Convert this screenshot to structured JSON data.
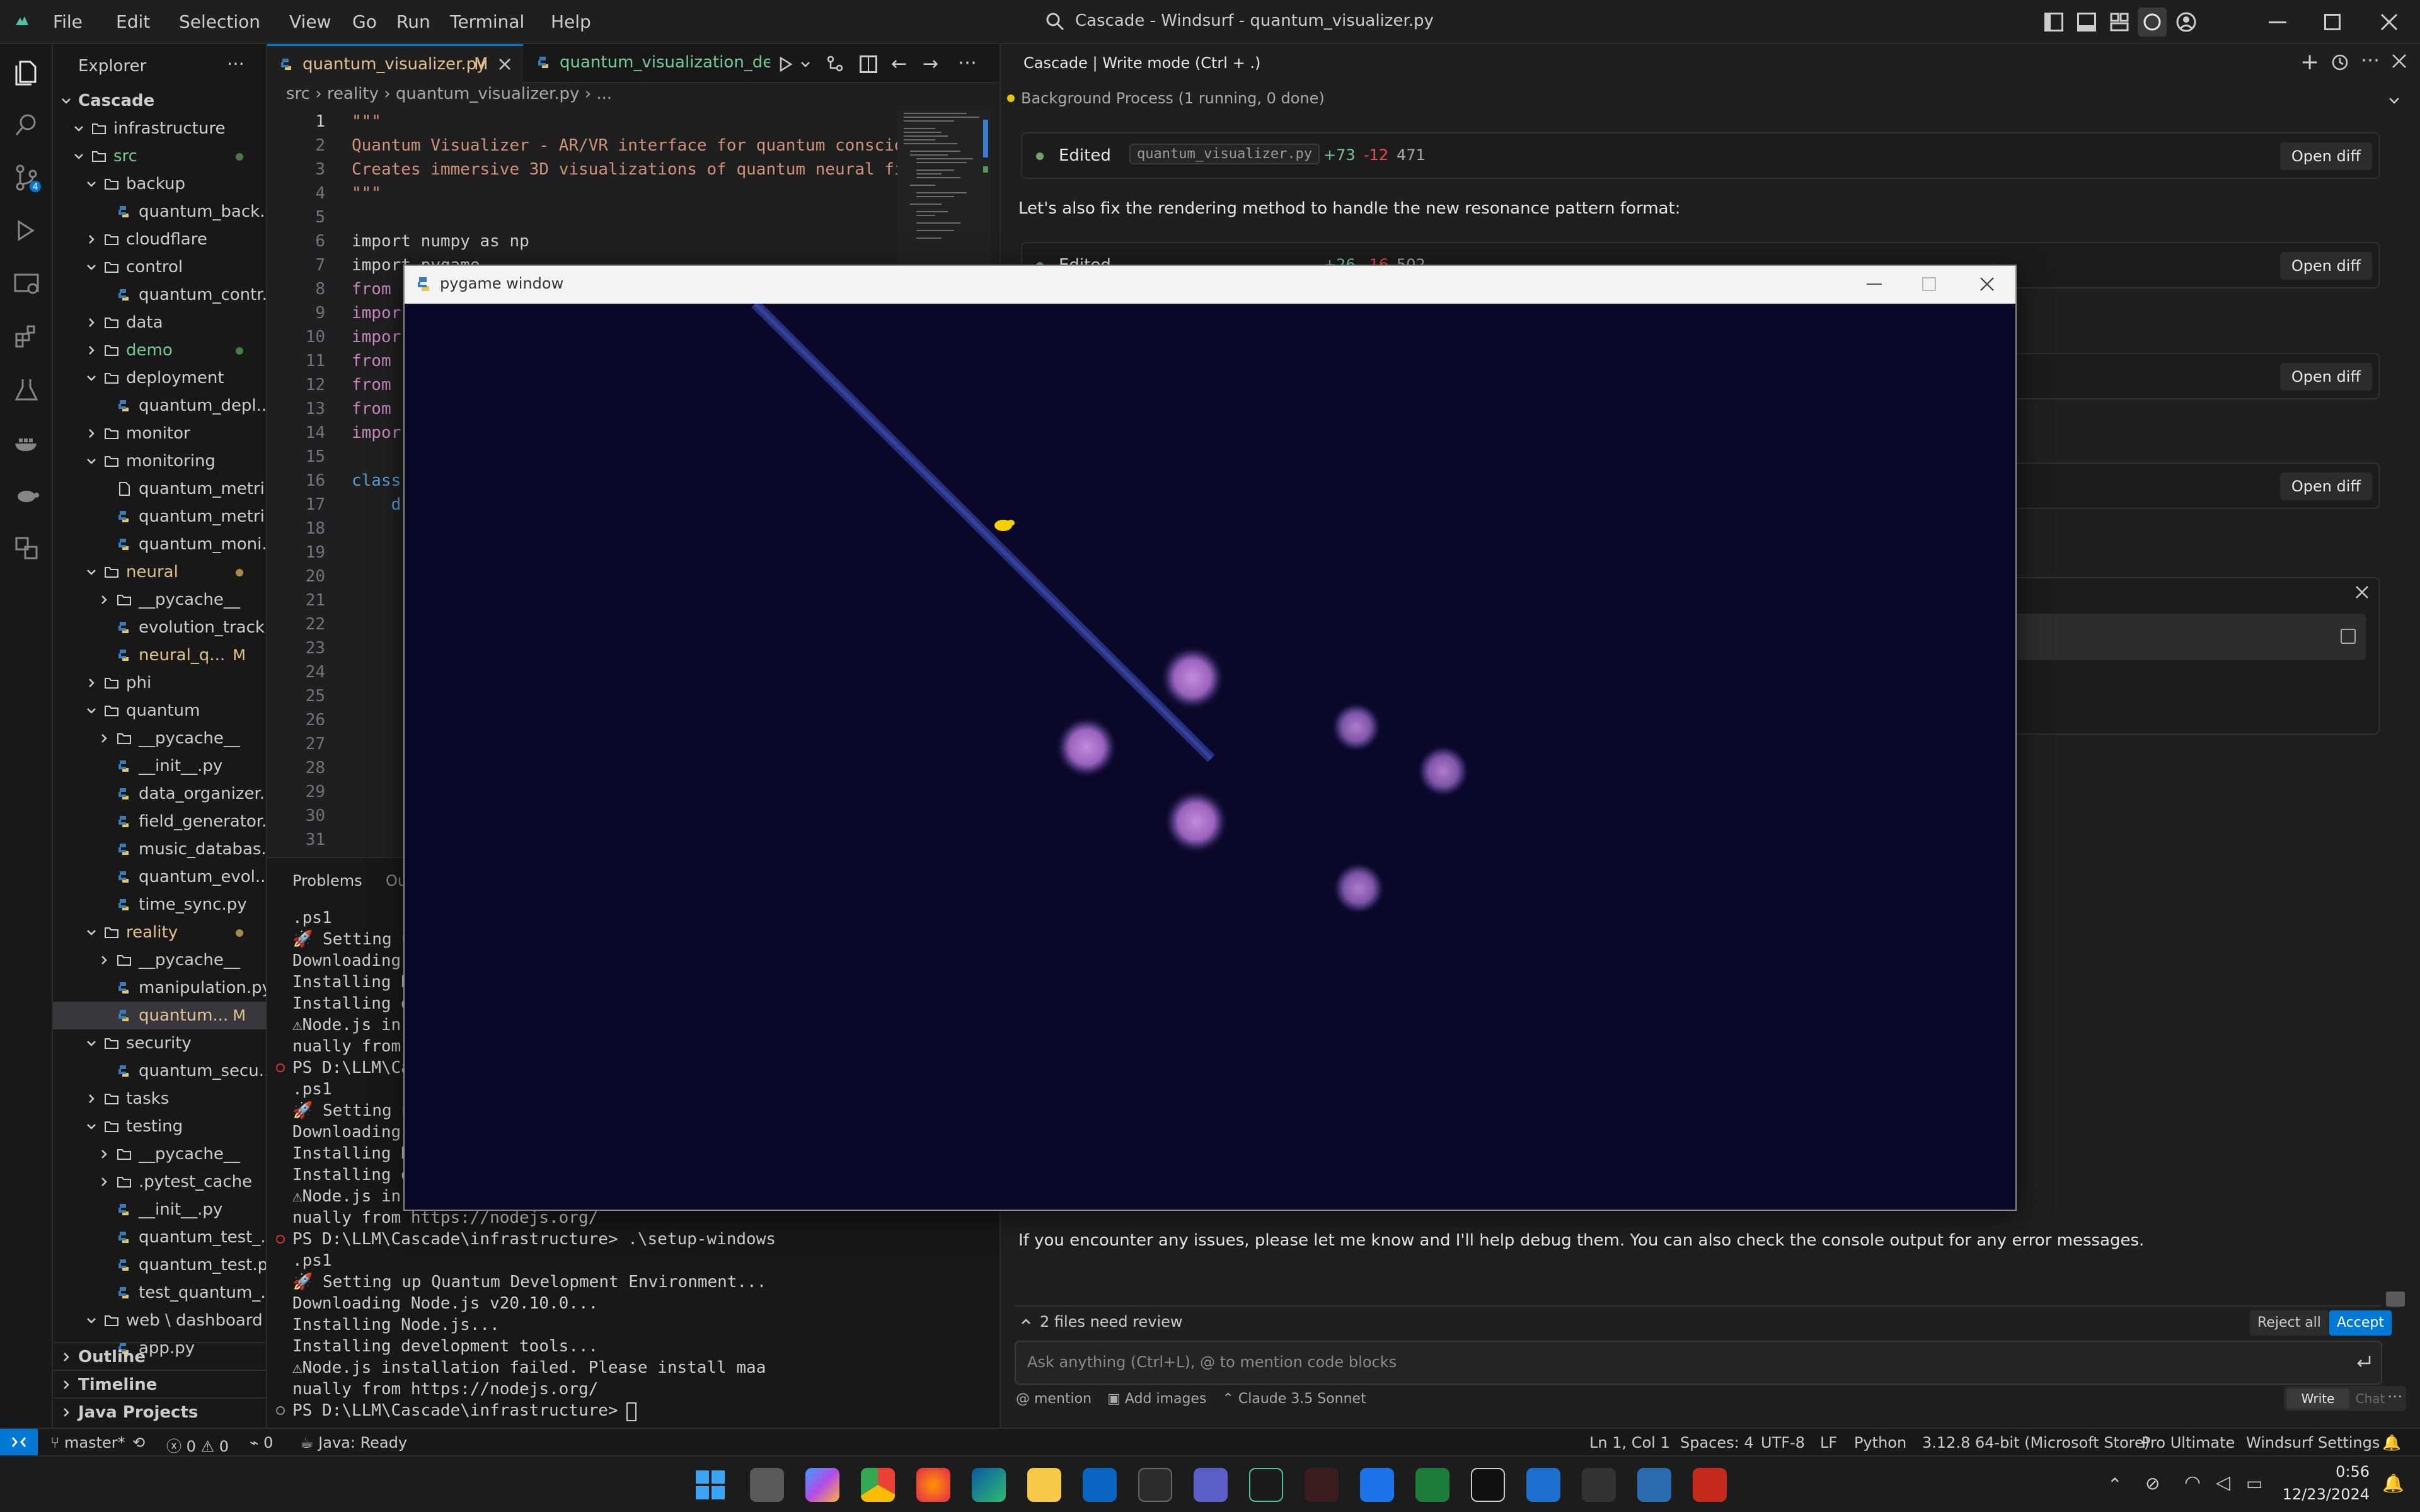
{
  "menu": [
    "File",
    "Edit",
    "Selection",
    "View",
    "Go",
    "Run",
    "Terminal",
    "Help"
  ],
  "window_title": "Cascade - Windsurf - quantum_visualizer.py",
  "explorer": {
    "title": "Explorer",
    "root": "Cascade",
    "items": [
      {
        "label": "infrastructure",
        "depth": 1,
        "type": "folder",
        "open": true
      },
      {
        "label": "src",
        "depth": 1,
        "type": "folder",
        "open": true,
        "color": "green",
        "dot": true
      },
      {
        "label": "backup",
        "depth": 2,
        "type": "folder",
        "open": true
      },
      {
        "label": "quantum_back...",
        "depth": 3,
        "type": "py"
      },
      {
        "label": "cloudflare",
        "depth": 2,
        "type": "folder",
        "open": false
      },
      {
        "label": "control",
        "depth": 2,
        "type": "folder",
        "open": true
      },
      {
        "label": "quantum_contr...",
        "depth": 3,
        "type": "py"
      },
      {
        "label": "data",
        "depth": 2,
        "type": "folder",
        "open": false
      },
      {
        "label": "demo",
        "depth": 2,
        "type": "folder",
        "open": false,
        "color": "green",
        "dot": true
      },
      {
        "label": "deployment",
        "depth": 2,
        "type": "folder",
        "open": true
      },
      {
        "label": "quantum_depl...",
        "depth": 3,
        "type": "py"
      },
      {
        "label": "monitor",
        "depth": 2,
        "type": "folder",
        "open": false
      },
      {
        "label": "monitoring",
        "depth": 2,
        "type": "folder",
        "open": true
      },
      {
        "label": "quantum_metri...",
        "depth": 3,
        "type": "file"
      },
      {
        "label": "quantum_metri...",
        "depth": 3,
        "type": "py"
      },
      {
        "label": "quantum_moni...",
        "depth": 3,
        "type": "py"
      },
      {
        "label": "neural",
        "depth": 2,
        "type": "folder",
        "open": true,
        "color": "yellow",
        "dot": true
      },
      {
        "label": "__pycache__",
        "depth": 3,
        "type": "folder",
        "open": false
      },
      {
        "label": "evolution_track...",
        "depth": 3,
        "type": "py"
      },
      {
        "label": "neural_q...",
        "depth": 3,
        "type": "py",
        "color": "yellow",
        "badge": "M"
      },
      {
        "label": "phi",
        "depth": 2,
        "type": "folder",
        "open": false
      },
      {
        "label": "quantum",
        "depth": 2,
        "type": "folder",
        "open": true
      },
      {
        "label": "__pycache__",
        "depth": 3,
        "type": "folder",
        "open": false
      },
      {
        "label": "__init__.py",
        "depth": 3,
        "type": "py"
      },
      {
        "label": "data_organizer...",
        "depth": 3,
        "type": "py"
      },
      {
        "label": "field_generator...",
        "depth": 3,
        "type": "py"
      },
      {
        "label": "music_databas...",
        "depth": 3,
        "type": "py"
      },
      {
        "label": "quantum_evol...",
        "depth": 3,
        "type": "py"
      },
      {
        "label": "time_sync.py",
        "depth": 3,
        "type": "py"
      },
      {
        "label": "reality",
        "depth": 2,
        "type": "folder",
        "open": true,
        "color": "yellow",
        "dot": true
      },
      {
        "label": "__pycache__",
        "depth": 3,
        "type": "folder",
        "open": false
      },
      {
        "label": "manipulation.py",
        "depth": 3,
        "type": "py"
      },
      {
        "label": "quantum...",
        "depth": 3,
        "type": "py",
        "color": "yellow",
        "badge": "M",
        "selected": true
      },
      {
        "label": "security",
        "depth": 2,
        "type": "folder",
        "open": true
      },
      {
        "label": "quantum_secu...",
        "depth": 3,
        "type": "py"
      },
      {
        "label": "tasks",
        "depth": 2,
        "type": "folder",
        "open": false
      },
      {
        "label": "testing",
        "depth": 2,
        "type": "folder",
        "open": true
      },
      {
        "label": "__pycache__",
        "depth": 3,
        "type": "folder",
        "open": false
      },
      {
        "label": ".pytest_cache",
        "depth": 3,
        "type": "folder",
        "open": false
      },
      {
        "label": "__init__.py",
        "depth": 3,
        "type": "py"
      },
      {
        "label": "quantum_test_...",
        "depth": 3,
        "type": "py"
      },
      {
        "label": "quantum_test.py",
        "depth": 3,
        "type": "py"
      },
      {
        "label": "test_quantum_...",
        "depth": 3,
        "type": "py"
      },
      {
        "label": "web \\ dashboard",
        "depth": 2,
        "type": "folder",
        "open": true
      },
      {
        "label": "app.py",
        "depth": 3,
        "type": "py"
      }
    ],
    "sections": [
      "Outline",
      "Timeline",
      "Java Projects"
    ]
  },
  "tabs": [
    {
      "label": "quantum_visualizer.py",
      "badge": "M",
      "active": true
    },
    {
      "label": "quantum_visualization_demo",
      "active": false
    }
  ],
  "breadcrumb": [
    "src",
    "reality",
    "quantum_visualizer.py",
    "..."
  ],
  "code_lines": [
    {
      "n": "1",
      "text": "\"\"\"",
      "c": "#ce9178"
    },
    {
      "n": "2",
      "text": "Quantum Visualizer - AR/VR interface for quantum consciousness",
      "c": "#ce9178"
    },
    {
      "n": "3",
      "text": "Creates immersive 3D visualizations of quantum neural fi",
      "c": "#ce9178"
    },
    {
      "n": "4",
      "text": "\"\"\"",
      "c": "#ce9178"
    },
    {
      "n": "5",
      "text": "",
      "c": "#cccccc"
    },
    {
      "n": "6",
      "text": "import numpy as np",
      "c": "#cccccc"
    },
    {
      "n": "7",
      "text": "import pygame",
      "c": "#cccccc"
    },
    {
      "n": "8",
      "text": "from",
      "c": "#c586c0"
    },
    {
      "n": "9",
      "text": "impor",
      "c": "#c586c0"
    },
    {
      "n": "10",
      "text": "impor",
      "c": "#c586c0"
    },
    {
      "n": "11",
      "text": "from",
      "c": "#c586c0"
    },
    {
      "n": "12",
      "text": "from",
      "c": "#c586c0"
    },
    {
      "n": "13",
      "text": "from",
      "c": "#c586c0"
    },
    {
      "n": "14",
      "text": "impor",
      "c": "#c586c0"
    },
    {
      "n": "15",
      "text": "",
      "c": "#cccccc"
    },
    {
      "n": "16",
      "text": "class",
      "c": "#569cd6"
    },
    {
      "n": "17",
      "text": "    d",
      "c": "#569cd6"
    },
    {
      "n": "18",
      "text": "",
      "c": "#cccccc"
    },
    {
      "n": "19",
      "text": "",
      "c": "#cccccc"
    },
    {
      "n": "20",
      "text": "",
      "c": "#cccccc"
    },
    {
      "n": "21",
      "text": "",
      "c": "#cccccc"
    },
    {
      "n": "22",
      "text": "",
      "c": "#cccccc"
    },
    {
      "n": "23",
      "text": "",
      "c": "#cccccc"
    },
    {
      "n": "24",
      "text": "",
      "c": "#cccccc"
    },
    {
      "n": "25",
      "text": "",
      "c": "#cccccc"
    },
    {
      "n": "26",
      "text": "",
      "c": "#cccccc"
    },
    {
      "n": "27",
      "text": "",
      "c": "#cccccc"
    },
    {
      "n": "28",
      "text": "",
      "c": "#cccccc"
    },
    {
      "n": "29",
      "text": "",
      "c": "#cccccc"
    },
    {
      "n": "30",
      "text": "",
      "c": "#cccccc"
    },
    {
      "n": "31",
      "text": "",
      "c": "#cccccc"
    }
  ],
  "panel": {
    "tabs": [
      "Problems",
      "Ou"
    ],
    "lines": [
      {
        "t": ".ps1",
        "k": "plain"
      },
      {
        "t": "🚀 Setting u",
        "k": "plain"
      },
      {
        "t": "Downloading",
        "k": "plain"
      },
      {
        "t": "Installing N",
        "k": "plain"
      },
      {
        "t": "Installing d",
        "k": "plain"
      },
      {
        "t": "⚠Node.js in",
        "k": "plain"
      },
      {
        "t": "nually from",
        "k": "plain"
      },
      {
        "t": "PS D:\\LLM\\Cas",
        "k": "prompt-err"
      },
      {
        "t": ".ps1",
        "k": "plain"
      },
      {
        "t": "🚀 Setting u",
        "k": "plain"
      },
      {
        "t": "Downloading",
        "k": "plain"
      },
      {
        "t": "Installing N",
        "k": "plain"
      },
      {
        "t": "Installing d",
        "k": "plain"
      },
      {
        "t": "⚠Node.js in",
        "k": "plain"
      },
      {
        "t": "nually from https://nodejs.org/",
        "k": "plain"
      },
      {
        "t": "PS D:\\LLM\\Cascade\\infrastructure> .\\setup-windows",
        "k": "prompt-err"
      },
      {
        "t": ".ps1",
        "k": "plain"
      },
      {
        "t": "🚀 Setting up Quantum Development Environment...",
        "k": "plain"
      },
      {
        "t": "Downloading Node.js v20.10.0...",
        "k": "plain"
      },
      {
        "t": "Installing Node.js...",
        "k": "plain"
      },
      {
        "t": "Installing development tools...",
        "k": "plain"
      },
      {
        "t": "⚠Node.js installation failed. Please install maa",
        "k": "plain"
      },
      {
        "t": "nually from https://nodejs.org/",
        "k": "plain"
      },
      {
        "t": "PS D:\\LLM\\Cascade\\infrastructure> ",
        "k": "prompt"
      }
    ]
  },
  "cascade": {
    "header": "Cascade | Write mode (Ctrl + .)",
    "bg_process": "Background Process (1 running, 0 done)",
    "edit_card": {
      "label": "Edited",
      "file": "quantum_visualizer.py",
      "plus": "+73",
      "minus": "-12",
      "count": "471",
      "button": "Open diff"
    },
    "message1": "Let's also fix the rendering method to handle the new resonance pattern format:",
    "partial_card": {
      "label": "Edited",
      "plus": "+26",
      "minus": "-16",
      "count": "502"
    },
    "open_diff": "Open diff",
    "final_message": "If you encounter any issues, please let me know and I'll help debug them. You can also check the console output for any error messages.",
    "review": "2 files need review",
    "reject_all": "Reject all",
    "accept_all": "Accept all",
    "input_placeholder": "Ask anything (Ctrl+L), @ to mention code blocks",
    "mention": "mention",
    "add_images": "Add images",
    "model": "Claude 3.5 Sonnet",
    "mode_write": "Write",
    "mode_chat": "Chat"
  },
  "pygame": {
    "title": "pygame window"
  },
  "status": {
    "branch": "master*",
    "errors": "0",
    "warnings": "0",
    "ports": "0",
    "java": "Java: Ready",
    "position": "Ln 1, Col 1",
    "spaces": "Spaces: 4",
    "encoding": "UTF-8",
    "eol": "LF",
    "language": "Python",
    "interpreter": "3.12.8 64-bit (Microsoft Store)",
    "plan": "Pro Ultimate",
    "settings": "Windsurf Settings"
  },
  "taskbar": {
    "time": "0:56",
    "date": "12/23/2024"
  },
  "colors": {
    "accent": "#0078d4",
    "green": "#73a36b",
    "yellow": "#e2c08d",
    "pg_bg": "#0a0828"
  }
}
